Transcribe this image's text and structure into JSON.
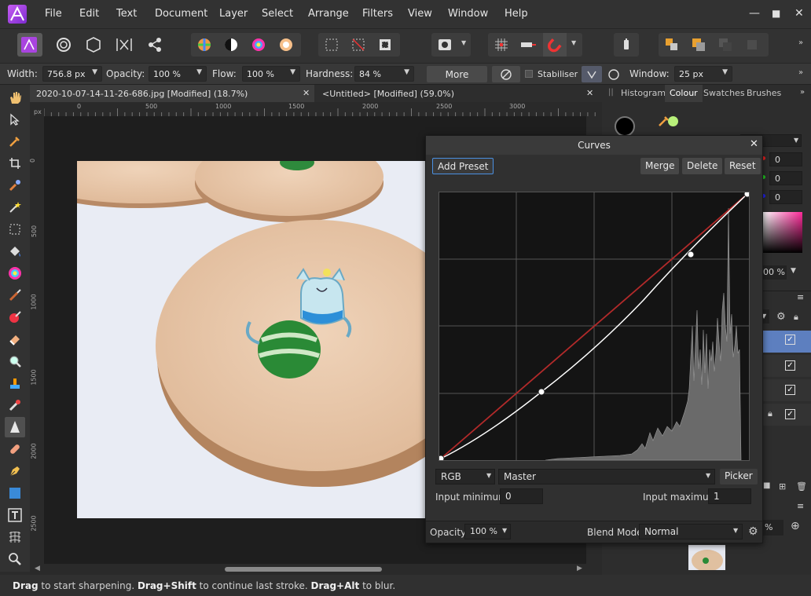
{
  "menu": [
    "File",
    "Edit",
    "Text",
    "Document",
    "Layer",
    "Select",
    "Arrange",
    "Filters",
    "View",
    "Window",
    "Help"
  ],
  "window_controls": {
    "minimize": "—",
    "maximize": "■",
    "close": "✕"
  },
  "context": {
    "width_label": "Width:",
    "width_value": "756.8 px",
    "opacity_label": "Opacity:",
    "opacity_value": "100 %",
    "flow_label": "Flow:",
    "flow_value": "100 %",
    "hardness_label": "Hardness:",
    "hardness_value": "84 %",
    "more": "More",
    "stabiliser": "Stabiliser",
    "window_label": "Window:",
    "window_value": "25 px"
  },
  "tabs": [
    {
      "label": "2020-10-07-14-11-26-686.jpg [Modified] (18.7%)",
      "close": "✕"
    },
    {
      "label": "<Untitled> [Modified] (59.0%)",
      "close": "✕"
    }
  ],
  "ruler": {
    "unit": "px",
    "h_ticks": [
      "0",
      "500",
      "1000",
      "1500",
      "2000",
      "2500",
      "3000"
    ],
    "v_ticks": [
      "0",
      "500",
      "1000",
      "1500",
      "2000",
      "2500"
    ]
  },
  "panel_tabs": [
    "Histogram",
    "Colour",
    "Swatches",
    "Brushes"
  ],
  "colour_panel": {
    "values": [
      "0",
      "0",
      "0"
    ],
    "opacity": "00 %"
  },
  "layer_opacity": "%",
  "curves": {
    "title": "Curves",
    "add_preset": "Add Preset",
    "merge": "Merge",
    "delete": "Delete",
    "reset": "Reset",
    "colorspace": "RGB",
    "channel": "Master",
    "picker": "Picker",
    "input_min_label": "Input minimum:",
    "input_min": "0",
    "input_max_label": "Input maximum:",
    "input_max": "1",
    "opacity_label": "Opacity:",
    "opacity": "100 %",
    "blend_label": "Blend Mode:",
    "blend": "Normal"
  },
  "status": {
    "k1": "Drag",
    "t1": " to start sharpening. ",
    "k2": "Drag+Shift",
    "t2": " to continue last stroke. ",
    "k3": "Drag+Alt",
    "t3": " to blur."
  },
  "colors": {
    "accent": "#4a90e2",
    "brand": "#a944e0",
    "selected_layer": "#5d7fbf"
  }
}
